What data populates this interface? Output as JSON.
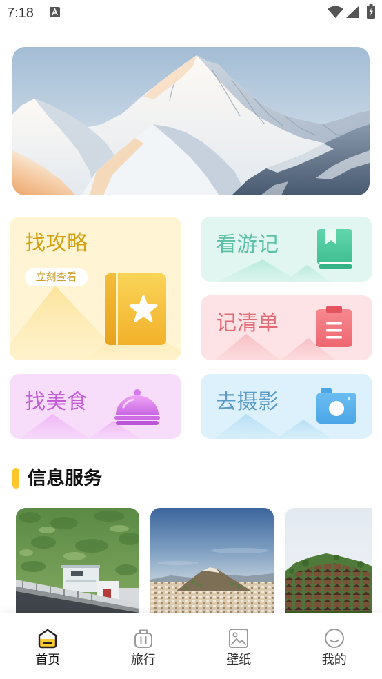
{
  "status_bar": {
    "time": "7:18",
    "icons": {
      "notification": "a-notification-icon",
      "wifi": "wifi-icon",
      "signal": "signal-icon",
      "battery": "battery-charging-icon"
    }
  },
  "features": {
    "guide": {
      "title": "找攻略",
      "button": "立刻查看",
      "icon": "book-star-icon",
      "text_color": "#D4A20F",
      "button_color": "#C9A22C",
      "bg_color": "#FFF5D5"
    },
    "travelogue": {
      "title": "看游记",
      "icon": "bookmark-book-icon",
      "text_color": "#5CC0A6",
      "bg_color": "#E1F6F0"
    },
    "checklist": {
      "title": "记清单",
      "icon": "clipboard-icon",
      "text_color": "#E06B74",
      "bg_color": "#FDE3E5"
    },
    "food": {
      "title": "找美食",
      "icon": "cloche-icon",
      "text_color": "#C35DD7",
      "bg_color": "#F8DDFB"
    },
    "photo": {
      "title": "去摄影",
      "icon": "camera-icon",
      "text_color": "#5B9BC5",
      "bg_color": "#DCF1FB"
    }
  },
  "info_section": {
    "title": "信息服务",
    "accent_color": "#FBC62E"
  },
  "bottom_nav": {
    "items": [
      {
        "label": "首页",
        "icon": "home-icon",
        "active": true
      },
      {
        "label": "旅行",
        "icon": "luggage-icon",
        "active": false
      },
      {
        "label": "壁纸",
        "icon": "wallpaper-icon",
        "active": false
      },
      {
        "label": "我的",
        "icon": "profile-smile-icon",
        "active": false
      }
    ]
  }
}
